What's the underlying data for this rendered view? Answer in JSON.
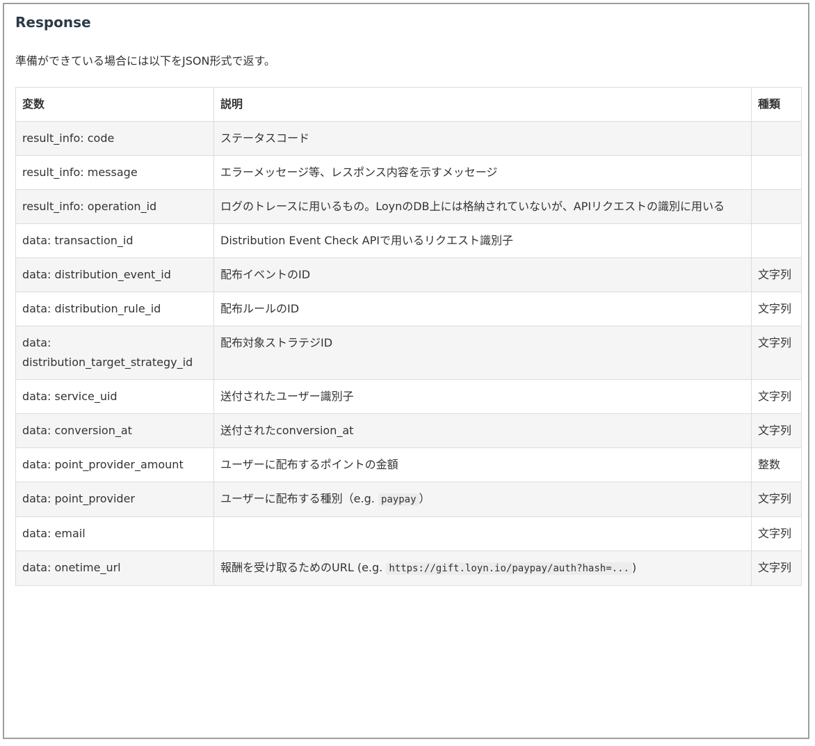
{
  "section": {
    "title": "Response",
    "intro": "準備ができている場合には以下をJSON形式で返す。"
  },
  "table": {
    "headers": [
      "変数",
      "説明",
      "種類"
    ],
    "rows": [
      {
        "variable": "result_info: code",
        "description": "ステータスコード",
        "desc_code": "",
        "desc_suffix": "",
        "type": ""
      },
      {
        "variable": "result_info: message",
        "description": "エラーメッセージ等、レスポンス内容を示すメッセージ",
        "desc_code": "",
        "desc_suffix": "",
        "type": ""
      },
      {
        "variable": "result_info: operation_id",
        "description": "ログのトレースに用いるもの。LoynのDB上には格納されていないが、APIリクエストの識別に用いる",
        "desc_code": "",
        "desc_suffix": "",
        "type": ""
      },
      {
        "variable": "data: transaction_id",
        "description": "Distribution Event Check APIで用いるリクエスト識別子",
        "desc_code": "",
        "desc_suffix": "",
        "type": ""
      },
      {
        "variable": "data: distribution_event_id",
        "description": "配布イベントのID",
        "desc_code": "",
        "desc_suffix": "",
        "type": "文字列"
      },
      {
        "variable": "data: distribution_rule_id",
        "description": "配布ルールのID",
        "desc_code": "",
        "desc_suffix": "",
        "type": "文字列"
      },
      {
        "variable": "data: distribution_target_strategy_id",
        "description": "配布対象ストラテジID",
        "desc_code": "",
        "desc_suffix": "",
        "type": "文字列"
      },
      {
        "variable": "data: service_uid",
        "description": "送付されたユーザー識別子",
        "desc_code": "",
        "desc_suffix": "",
        "type": "文字列"
      },
      {
        "variable": "data: conversion_at",
        "description": "送付されたconversion_at",
        "desc_code": "",
        "desc_suffix": "",
        "type": "文字列"
      },
      {
        "variable": "data: point_provider_amount",
        "description": "ユーザーに配布するポイントの金額",
        "desc_code": "",
        "desc_suffix": "",
        "type": "整数"
      },
      {
        "variable": "data: point_provider",
        "description": "ユーザーに配布する種別（e.g. ",
        "desc_code": "paypay",
        "desc_suffix": "）",
        "type": "文字列"
      },
      {
        "variable": "data: email",
        "description": "",
        "desc_code": "",
        "desc_suffix": "",
        "type": "文字列"
      },
      {
        "variable": "data: onetime_url",
        "description": "報酬を受け取るためのURL (e.g. ",
        "desc_code": "https://gift.loyn.io/paypay/auth?hash=...",
        "desc_suffix": ")",
        "type": "文字列"
      }
    ]
  }
}
